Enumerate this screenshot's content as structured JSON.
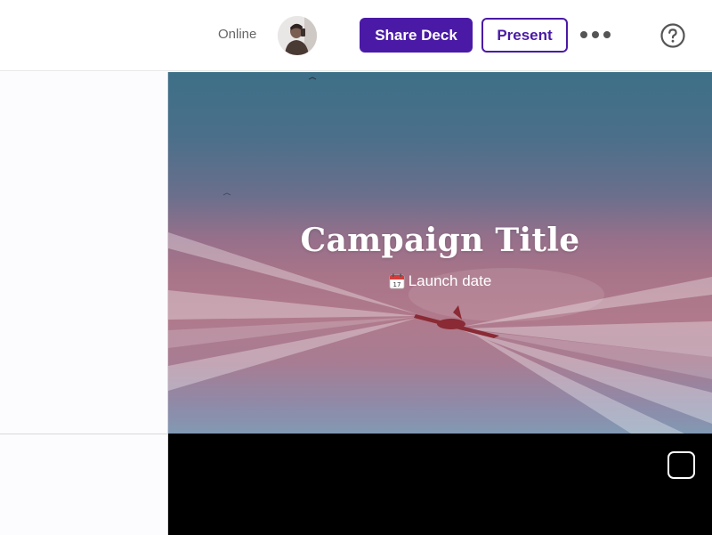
{
  "header": {
    "status_text": "Online",
    "share_label": "Share Deck",
    "present_label": "Present",
    "more_icon": "more-horizontal-icon",
    "help_icon": "help-circle-icon",
    "accent_color": "#4a1aa6"
  },
  "slide": {
    "title": "Campaign Title",
    "subtitle_icon": "calendar-icon",
    "subtitle": "Launch date"
  },
  "next_slide": {
    "icon": "rounded-square-icon",
    "background": "#000000"
  }
}
